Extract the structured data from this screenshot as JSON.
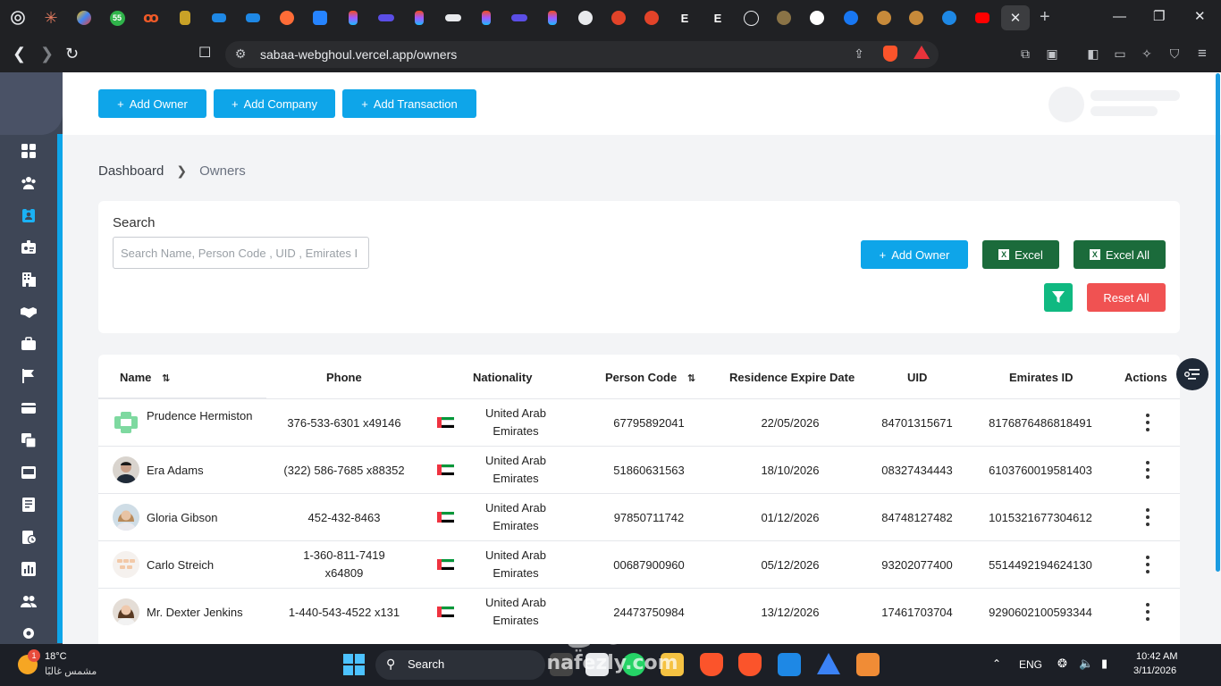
{
  "browser": {
    "url": "sabaa-webghoul.vercel.app/owners",
    "tab_badge": "55",
    "tab_letter_e": "E"
  },
  "header": {
    "add_owner": "Add Owner",
    "add_company": "Add Company",
    "add_transaction": "Add Transaction"
  },
  "breadcrumb": {
    "root": "Dashboard",
    "current": "Owners"
  },
  "filters": {
    "search_label": "Search",
    "search_placeholder": "Search Name, Person Code , UID , Emirates I",
    "add_owner": "Add Owner",
    "excel": "Excel",
    "excel_all": "Excel All",
    "reset_all": "Reset All"
  },
  "table": {
    "columns": [
      "Name",
      "Phone",
      "Nationality",
      "Person Code",
      "Residence Expire Date",
      "UID",
      "Emirates ID",
      "Actions"
    ],
    "rows": [
      {
        "name": "Prudence Hermiston",
        "phone": "376-533-6301 x49146",
        "nationality": "United Arab Emirates",
        "person_code": "67795892041",
        "expire": "22/05/2026",
        "uid": "84701315671",
        "emirates_id": "8176876486818491"
      },
      {
        "name": "Era Adams",
        "phone": "(322) 586-7685 x88352",
        "nationality": "United Arab Emirates",
        "person_code": "51860631563",
        "expire": "18/10/2026",
        "uid": "08327434443",
        "emirates_id": "6103760019581403"
      },
      {
        "name": "Gloria Gibson",
        "phone": "452-432-8463",
        "nationality": "United Arab Emirates",
        "person_code": "97850711742",
        "expire": "01/12/2026",
        "uid": "84748127482",
        "emirates_id": "1015321677304612"
      },
      {
        "name": "Carlo Streich",
        "phone": "1-360-811-7419 x64809",
        "nationality": "United Arab Emirates",
        "person_code": "00687900960",
        "expire": "05/12/2026",
        "uid": "93202077400",
        "emirates_id": "5514492194624130"
      },
      {
        "name": "Mr. Dexter Jenkins",
        "phone": "1-440-543-4522 x131",
        "nationality": "United Arab Emirates",
        "person_code": "24473750984",
        "expire": "13/12/2026",
        "uid": "17461703704",
        "emirates_id": "9290602100593344"
      }
    ]
  },
  "taskbar": {
    "weather_badge": "1",
    "temperature": "18°C",
    "weather_desc": "مشمس غالبًا",
    "search": "Search",
    "language": "ENG",
    "time": "10:42 AM",
    "date": "3/11/2026"
  },
  "watermark": {
    "arabic": "نفذلي",
    "latin": "nafezly.com"
  },
  "colors": {
    "accent_blue": "#0ea5e9",
    "excel_green": "#1b6b3b",
    "filter_green": "#10b981",
    "reset_red": "#f05252",
    "sidebar": "#3e4656"
  }
}
